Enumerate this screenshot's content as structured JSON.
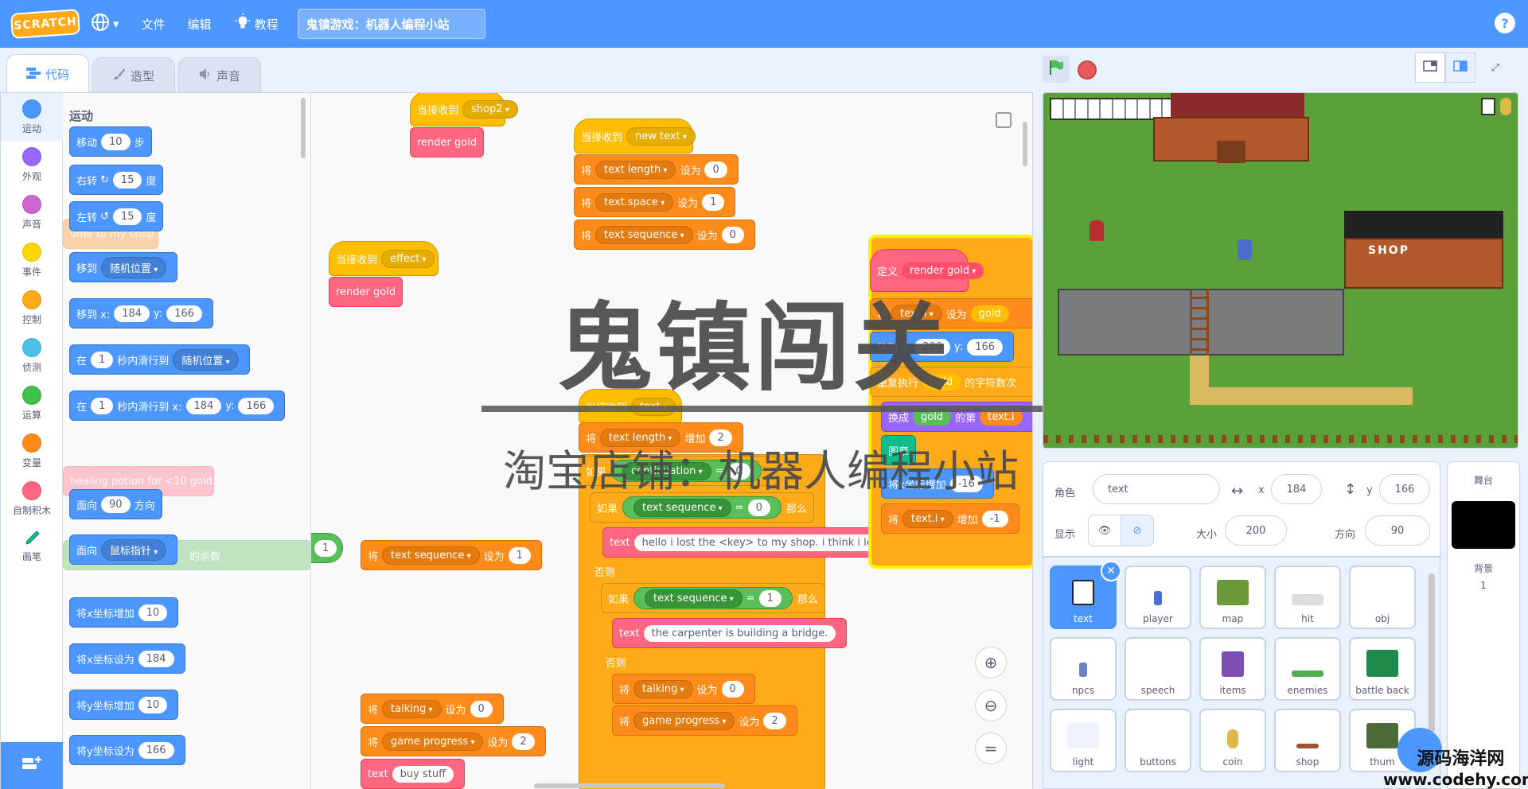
{
  "menubar": {
    "logo": "SCRATCH",
    "file": "文件",
    "edit": "编辑",
    "tutorials": "教程",
    "project_title": "鬼镇游戏：机器人编程小站",
    "help": "?"
  },
  "tabs": [
    {
      "label": "代码"
    },
    {
      "label": "造型"
    },
    {
      "label": "声音"
    }
  ],
  "categories": [
    {
      "label": "运动",
      "color": "#4c97ff"
    },
    {
      "label": "外观",
      "color": "#9966ff"
    },
    {
      "label": "声音",
      "color": "#cf63cf"
    },
    {
      "label": "事件",
      "color": "#ffd500"
    },
    {
      "label": "控制",
      "color": "#ffab19"
    },
    {
      "label": "侦测",
      "color": "#4cbfe6"
    },
    {
      "label": "运算",
      "color": "#40bf4a"
    },
    {
      "label": "变量",
      "color": "#ff8c1a"
    },
    {
      "label": "自制积木",
      "color": "#ff6680"
    },
    {
      "label": "画笔",
      "color": "#0fbd8c"
    }
  ],
  "palette": {
    "heading": "运动",
    "move": {
      "a": "移动",
      "v": "10",
      "b": "步"
    },
    "turn_right": {
      "a": "右转",
      "v": "15",
      "b": "度"
    },
    "turn_left": {
      "a": "左转",
      "v": "15",
      "b": "度"
    },
    "goto": {
      "a": "移到",
      "d": "随机位置"
    },
    "goto_xy": {
      "a": "移到 x:",
      "x": "184",
      "b": "y:",
      "y": "166"
    },
    "glide": {
      "a": "在",
      "v": "1",
      "b": "秒内滑行到",
      "d": "随机位置"
    },
    "glide_xy": {
      "a": "在",
      "v": "1",
      "b": "秒内滑行到 x:",
      "x": "184",
      "c": "y:",
      "y": "166"
    },
    "point_dir": {
      "a": "面向",
      "v": "90",
      "b": "方向"
    },
    "point_towards": {
      "a": "面向",
      "d": "鼠标指针"
    },
    "change_x": {
      "a": "将x坐标增加",
      "v": "10"
    },
    "set_x": {
      "a": "将x坐标设为",
      "v": "184"
    },
    "change_y": {
      "a": "将y坐标增加",
      "v": "10"
    },
    "set_y": {
      "a": "将y坐标设为",
      "v": "166"
    },
    "ghost_texts": [
      "ome to my shop",
      "healing potion for <10 gold>",
      "那么",
      "的余数"
    ]
  },
  "workspace": {
    "shop2": {
      "hat": "当接收到",
      "msg": "shop2",
      "call": "render gold"
    },
    "effect": {
      "hat": "当接收到",
      "msg": "effect",
      "call": "render gold"
    },
    "newtext": {
      "hat": "当接收到",
      "msg": "new text",
      "rows": [
        {
          "a": "将",
          "var": "text length",
          "b": "设为",
          "v": "0"
        },
        {
          "a": "将",
          "var": "text.space",
          "b": "设为",
          "v": "1"
        },
        {
          "a": "将",
          "var": "text sequence",
          "b": "设为",
          "v": "0"
        }
      ]
    },
    "text_script": {
      "hat": "当接收到",
      "msg": "text",
      "inc": {
        "a": "将",
        "var": "text length",
        "b": "增加",
        "v": "2"
      },
      "if_label": "如果",
      "continuation": "continuation",
      "then": "那么",
      "if2": {
        "a": "如果",
        "var": "text sequence",
        "eq": "=",
        "v": "0",
        "then": "那么"
      },
      "text1": {
        "call": "text",
        "v": "hello i lost the <key> to my shop. i think i left it t"
      },
      "else1": "否则",
      "if3": {
        "a": "如果",
        "var": "text sequence",
        "eq": "=",
        "v": "1",
        "then": "那么"
      },
      "text2": {
        "call": "text",
        "v": "the carpenter is building a bridge."
      },
      "else2": "否则",
      "set_talking": {
        "a": "将",
        "var": "talking",
        "b": "设为",
        "v": "0"
      },
      "set_progress": {
        "a": "将",
        "var": "game progress",
        "b": "设为",
        "v": "2"
      }
    },
    "floating": {
      "a": "将",
      "var": "text sequence",
      "b": "设为",
      "v": "1",
      "cond_v": "1"
    },
    "bottom": {
      "r1": {
        "a": "将",
        "var": "talking",
        "b": "设为",
        "v": "0"
      },
      "r2": {
        "a": "将",
        "var": "game progress",
        "b": "设为",
        "v": "2"
      },
      "r3": {
        "call": "text",
        "v": "buy stuff"
      }
    },
    "define": {
      "hat": "定义",
      "name": "render gold",
      "set_row": {
        "a": "将",
        "var": "text.i",
        "b": "设为",
        "v": "gold"
      },
      "goto": {
        "a": "移到 x:",
        "x": "200",
        "b": "y:",
        "y": "166"
      },
      "repeat": {
        "a": "重复执行",
        "v": "gold",
        "b": "的字符数",
        "c": "次"
      },
      "costume": {
        "a": "换成",
        "v1": "gold",
        "b": "的第",
        "v2": "text.i"
      },
      "stamp": "图章",
      "change_x": {
        "a": "将x坐标增加",
        "v": "-16"
      },
      "inc": {
        "a": "将",
        "var": "text.i",
        "b": "增加",
        "v": "-1"
      }
    }
  },
  "watermark": {
    "title": "鬼镇闯关",
    "subtitle": "淘宝店铺：机器人编程小站",
    "corner_a": "源码海洋网",
    "corner_b": "www.codehy.com"
  },
  "stage": {
    "shop_sign": "SHOP"
  },
  "sprite_info": {
    "sprite_label": "角色",
    "sprite_name": "text",
    "x_label": "x",
    "x": "184",
    "y_label": "y",
    "y": "166",
    "show_label": "显示",
    "size_label": "大小",
    "size": "200",
    "direction_label": "方向",
    "direction": "90"
  },
  "sprites": [
    {
      "name": "text",
      "color": "#ffffff"
    },
    {
      "name": "player",
      "color": "#4c6ccf"
    },
    {
      "name": "map",
      "color": "#6b9a3a"
    },
    {
      "name": "hit",
      "color": "#dddddd"
    },
    {
      "name": "obj",
      "color": "#ffffff"
    },
    {
      "name": "npcs",
      "color": "#6b83c6"
    },
    {
      "name": "speech",
      "color": "#ffffff"
    },
    {
      "name": "items",
      "color": "#7d4fb3"
    },
    {
      "name": "enemies",
      "color": "#4fae4f"
    },
    {
      "name": "battle back",
      "color": "#1f8a4a"
    },
    {
      "name": "light",
      "color": "#eef3ff"
    },
    {
      "name": "buttons",
      "color": "#ffffff"
    },
    {
      "name": "coin",
      "color": "#e0b84a"
    },
    {
      "name": "shop",
      "color": "#a0522d"
    },
    {
      "name": "thum",
      "color": "#4d6a3a"
    }
  ],
  "stage_target": {
    "label": "舞台",
    "backdrop_label": "背景",
    "backdrop_count": "1"
  }
}
